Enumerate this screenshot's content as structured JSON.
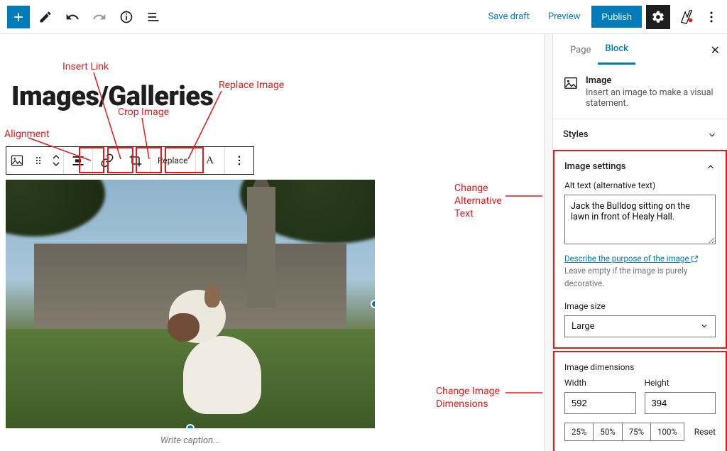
{
  "topbar": {
    "save_draft": "Save draft",
    "preview": "Preview",
    "publish": "Publish"
  },
  "page_title": "Images/Galleries",
  "toolbar": {
    "replace_label": "Replace"
  },
  "annotations": {
    "insert_link": "Insert Link",
    "replace_image": "Replace Image",
    "crop_image": "Crop Image",
    "alignment": "Alignment",
    "change_alt": "Change Alternative Text",
    "change_dims": "Change Image Dimensions"
  },
  "caption_placeholder": "Write caption...",
  "sidebar": {
    "tab_page": "Page",
    "tab_block": "Block",
    "block_name": "Image",
    "block_description": "Insert an image to make a visual statement.",
    "styles_label": "Styles",
    "image_settings_label": "Image settings",
    "alt_label": "Alt text (alternative text)",
    "alt_value": "Jack the Bulldog sitting on the lawn in front of Healy Hall.",
    "alt_help_link": "Describe the purpose of the image",
    "alt_help_rest": " Leave empty if the image is purely decorative.",
    "image_size_label": "Image size",
    "image_size_value": "Large",
    "image_dims_label": "Image dimensions",
    "width_label": "Width",
    "width_value": "592",
    "height_label": "Height",
    "height_value": "394",
    "pct_25": "25%",
    "pct_50": "50%",
    "pct_75": "75%",
    "pct_100": "100%",
    "reset": "Reset"
  }
}
